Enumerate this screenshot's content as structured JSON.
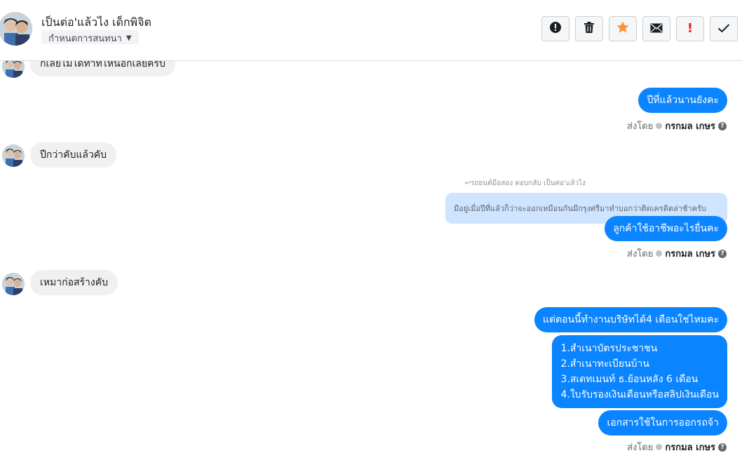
{
  "header": {
    "contact_name": "เป็นต่อ'แล้วไง เด็กพิจิต",
    "label_dropdown": "กำหนดการสนทนา",
    "actions": [
      {
        "icon": "exclamation-circle-icon"
      },
      {
        "icon": "trash-icon"
      },
      {
        "icon": "star-icon",
        "color": "#f7923b"
      },
      {
        "icon": "envelope-icon"
      },
      {
        "icon": "exclamation-mark-icon",
        "color": "#e02020"
      },
      {
        "icon": "checkmark-icon"
      }
    ]
  },
  "messages": {
    "m1_text": "ก็เลยไม่ได้ทำที่ไหนอีกเลยครับ",
    "m2_text": "ปีที่แล้วนานยังคะ",
    "m3_text": "ปีกว่าคับแล้วคับ",
    "reply_header": "↩รถยนต์มือสอง ตอบกลับ เป็นต่อ'แล้วไง",
    "reply_quote": "มีอยู่เมื่อปีที่แล้วก็ว่าจะออกเหมือนกันมีกรุงศรีมาทำบอกว่าติดเครดิตล่าช้าครับ",
    "m4_text": "ลูกค้าใช้อาชีพอะไรยื่นคะ",
    "m5_text": "เหมาก่อสร้างคับ",
    "m6_text": "แต่ตอนนี้ทำงานบริษัทได้4 เดือนใช่ไหมคะ",
    "m7_lines": [
      "1.สำเนาบัตรประชาชน",
      "2.สำเนาทะเบียนบ้าน",
      "3.สเตทเมนท์ ธ.ย้อนหลัง 6 เดือน",
      "4.ใบรับรองเงินเดือนหรือสลิปเงินเดือน"
    ],
    "m8_text": "เอกสารใช้ในการออกรถจ้า"
  },
  "sent_by": {
    "prefix": "ส่งโดย",
    "name": "กรกมล เกษร",
    "help": "?"
  },
  "colors": {
    "outgoing_bubble": "#0b84ff",
    "incoming_bubble": "#f1f0f0",
    "reply_quote_bg": "#cfe4ff"
  }
}
